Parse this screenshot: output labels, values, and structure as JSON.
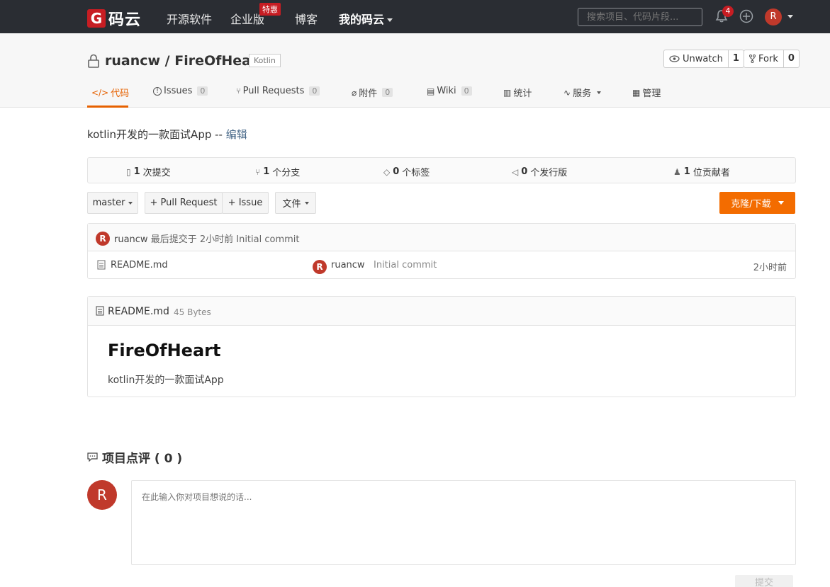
{
  "nav": {
    "logo_mark": "G",
    "logo_text": "码云",
    "items": [
      "开源软件",
      "企业版",
      "博客",
      "我的码云"
    ],
    "enterprise_badge": "特惠",
    "search_placeholder": "搜索项目、代码片段...",
    "notification_count": "4",
    "avatar_letter": "R"
  },
  "repo": {
    "owner_repo": "ruancw / FireOfHeart",
    "language": "Kotlin",
    "watch_label": "Unwatch",
    "watch_count": "1",
    "fork_label": "Fork",
    "fork_count": "0"
  },
  "tabs": {
    "code": "代码",
    "issues": "Issues",
    "issues_count": "0",
    "pull_requests": "Pull Requests",
    "pull_requests_count": "0",
    "attachments": "附件",
    "attachments_count": "0",
    "wiki": "Wiki",
    "wiki_count": "0",
    "stats": "统计",
    "services": "服务",
    "manage": "管理"
  },
  "description": {
    "text": "kotlin开发的一款面试App -- ",
    "edit": "编辑"
  },
  "stats": {
    "commits_num": "1",
    "commits_label": "次提交",
    "branches_num": "1",
    "branches_label": "个分支",
    "tags_num": "0",
    "tags_label": "个标签",
    "releases_num": "0",
    "releases_label": "个发行版",
    "contributors_num": "1",
    "contributors_label": "位贡献者"
  },
  "toolbar": {
    "branch": "master",
    "pull_request": "+ Pull Request",
    "issue": "+ Issue",
    "files": "文件",
    "clone": "克隆/下载"
  },
  "commit": {
    "avatar_letter": "R",
    "user": "ruancw",
    "text": " 最后提交于 2小时前 Initial commit"
  },
  "files": [
    {
      "name": "README.md",
      "user": "ruancw",
      "message": "Initial commit",
      "time": "2小时前",
      "avatar_letter": "R"
    }
  ],
  "readme": {
    "file_name": "README.md",
    "size": "45 Bytes",
    "heading": "FireOfHeart",
    "body": "kotlin开发的一款面试App"
  },
  "comments": {
    "title": "项目点评 ( 0 )",
    "avatar_letter": "R",
    "placeholder": "在此输入你对项目想说的话...",
    "submit": "提交"
  },
  "colors": {
    "nav_bg": "#2a2d33",
    "brand_red": "#c71d23",
    "accent_orange": "#f36c00"
  }
}
